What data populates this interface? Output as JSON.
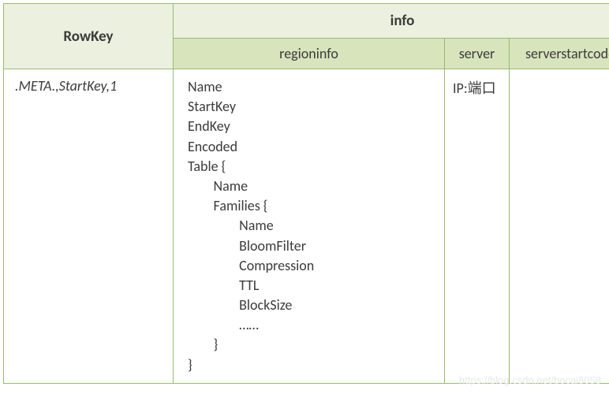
{
  "headers": {
    "rowkey": "RowKey",
    "info": "info",
    "regioninfo": "regioninfo",
    "server": "server",
    "serverstartcode": "serverstartcode"
  },
  "row": {
    "rowkey": ".META.,StartKey,1",
    "regioninfo": "Name\nStartKey\nEndKey\nEncoded\nTable {\n        Name\n        Families {\n                Name\n                BloomFilter\n                Compression\n                TTL\n                BlockSize\n                ……\n        }\n}",
    "server": "IP:端口",
    "serverstartcode": ""
  },
  "watermark": "https://blog.csdn.net/bocai8058"
}
